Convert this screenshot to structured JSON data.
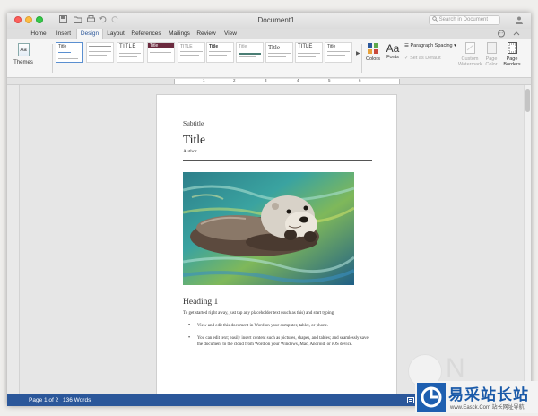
{
  "window": {
    "title": "Document1"
  },
  "search": {
    "placeholder": "Search in Document"
  },
  "ribbon_tabs": [
    {
      "label": "Home"
    },
    {
      "label": "Insert"
    },
    {
      "label": "Design",
      "active": true
    },
    {
      "label": "Layout"
    },
    {
      "label": "References"
    },
    {
      "label": "Mailings"
    },
    {
      "label": "Review"
    },
    {
      "label": "View"
    }
  ],
  "ribbon": {
    "themes_label": "Themes",
    "themes_icon_text": "Aa",
    "style_thumbs": [
      {
        "title": "Title"
      },
      {
        "title": ""
      },
      {
        "title": "TITLE"
      },
      {
        "title": "Title"
      },
      {
        "title": "TITLE"
      },
      {
        "title": "Title"
      },
      {
        "title": "Title"
      },
      {
        "title": "Title"
      },
      {
        "title": "TITLE"
      },
      {
        "title": "Title"
      }
    ],
    "colors_label": "Colors",
    "fonts_label": "Fonts",
    "fonts_icon_text": "Aa",
    "paragraph_spacing_label": "Paragraph Spacing",
    "set_default_label": "Set as Default",
    "watermark_label": "Custom Watermark",
    "page_color_label": "Page Color",
    "page_borders_label": "Page Borders"
  },
  "ruler": {
    "numbers": [
      "1",
      "2",
      "3",
      "4",
      "5",
      "6"
    ]
  },
  "document": {
    "subtitle": "Subtitle",
    "title": "Title",
    "author": "Author",
    "heading1": "Heading 1",
    "intro": "To get started right away, just tap any placeholder text (such as this) and start typing.",
    "bullets": [
      "View and edit this document in Word on your computer, tablet, or phone.",
      "You can edit text; easily insert content such as pictures, shapes, and tables; and seamlessly save the document to the cloud from Word on your Windows, Mac, Android, or iOS device."
    ]
  },
  "status": {
    "page": "Page 1 of 2",
    "words": "136 Words"
  },
  "watermark": {
    "letter": "N",
    "site_name": "易采站长站",
    "url": "www.Easck.Com 站长网址导航"
  },
  "colors": {
    "accent": "#2b579a",
    "tab_active": "#2b579a",
    "status_bar": "#2b579a"
  }
}
